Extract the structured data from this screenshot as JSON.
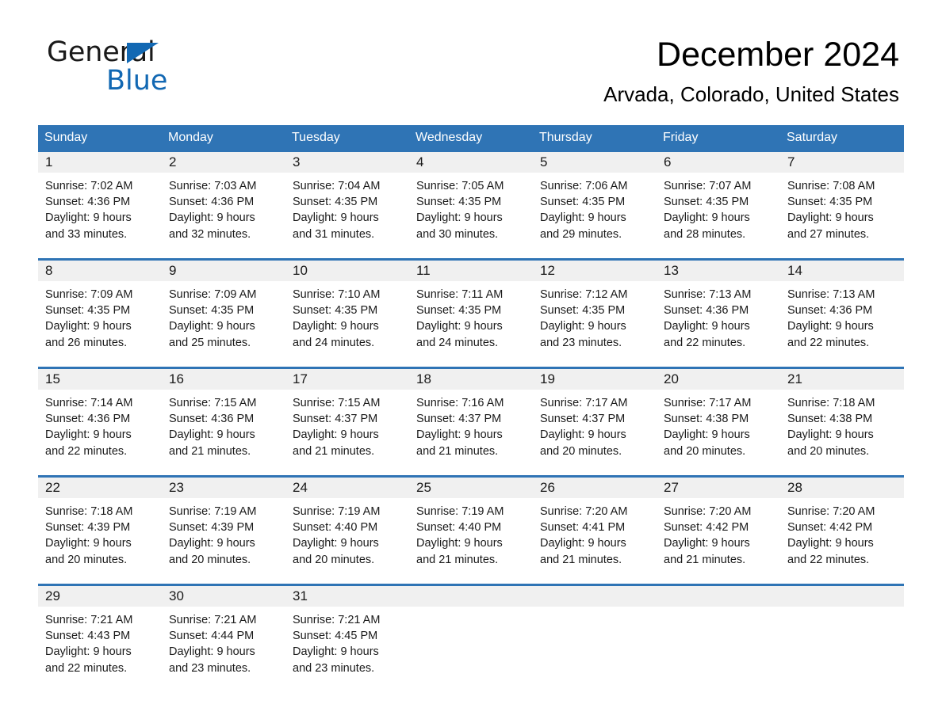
{
  "logo": {
    "word1": "General",
    "word2": "Blue",
    "triangle_color": "#1268b3"
  },
  "header": {
    "title": "December 2024",
    "location": "Arvada, Colorado, United States"
  },
  "theme": {
    "header_blue": "#2f74b5",
    "day_band_gray": "#f0f0f0",
    "text_color": "#1a1a1a"
  },
  "calendar": {
    "weekdays": [
      "Sunday",
      "Monday",
      "Tuesday",
      "Wednesday",
      "Thursday",
      "Friday",
      "Saturday"
    ],
    "weeks": [
      {
        "numbers": [
          "1",
          "2",
          "3",
          "4",
          "5",
          "6",
          "7"
        ],
        "cells": [
          {
            "sunrise": "Sunrise: 7:02 AM",
            "sunset": "Sunset: 4:36 PM",
            "daylight1": "Daylight: 9 hours",
            "daylight2": "and 33 minutes."
          },
          {
            "sunrise": "Sunrise: 7:03 AM",
            "sunset": "Sunset: 4:36 PM",
            "daylight1": "Daylight: 9 hours",
            "daylight2": "and 32 minutes."
          },
          {
            "sunrise": "Sunrise: 7:04 AM",
            "sunset": "Sunset: 4:35 PM",
            "daylight1": "Daylight: 9 hours",
            "daylight2": "and 31 minutes."
          },
          {
            "sunrise": "Sunrise: 7:05 AM",
            "sunset": "Sunset: 4:35 PM",
            "daylight1": "Daylight: 9 hours",
            "daylight2": "and 30 minutes."
          },
          {
            "sunrise": "Sunrise: 7:06 AM",
            "sunset": "Sunset: 4:35 PM",
            "daylight1": "Daylight: 9 hours",
            "daylight2": "and 29 minutes."
          },
          {
            "sunrise": "Sunrise: 7:07 AM",
            "sunset": "Sunset: 4:35 PM",
            "daylight1": "Daylight: 9 hours",
            "daylight2": "and 28 minutes."
          },
          {
            "sunrise": "Sunrise: 7:08 AM",
            "sunset": "Sunset: 4:35 PM",
            "daylight1": "Daylight: 9 hours",
            "daylight2": "and 27 minutes."
          }
        ]
      },
      {
        "numbers": [
          "8",
          "9",
          "10",
          "11",
          "12",
          "13",
          "14"
        ],
        "cells": [
          {
            "sunrise": "Sunrise: 7:09 AM",
            "sunset": "Sunset: 4:35 PM",
            "daylight1": "Daylight: 9 hours",
            "daylight2": "and 26 minutes."
          },
          {
            "sunrise": "Sunrise: 7:09 AM",
            "sunset": "Sunset: 4:35 PM",
            "daylight1": "Daylight: 9 hours",
            "daylight2": "and 25 minutes."
          },
          {
            "sunrise": "Sunrise: 7:10 AM",
            "sunset": "Sunset: 4:35 PM",
            "daylight1": "Daylight: 9 hours",
            "daylight2": "and 24 minutes."
          },
          {
            "sunrise": "Sunrise: 7:11 AM",
            "sunset": "Sunset: 4:35 PM",
            "daylight1": "Daylight: 9 hours",
            "daylight2": "and 24 minutes."
          },
          {
            "sunrise": "Sunrise: 7:12 AM",
            "sunset": "Sunset: 4:35 PM",
            "daylight1": "Daylight: 9 hours",
            "daylight2": "and 23 minutes."
          },
          {
            "sunrise": "Sunrise: 7:13 AM",
            "sunset": "Sunset: 4:36 PM",
            "daylight1": "Daylight: 9 hours",
            "daylight2": "and 22 minutes."
          },
          {
            "sunrise": "Sunrise: 7:13 AM",
            "sunset": "Sunset: 4:36 PM",
            "daylight1": "Daylight: 9 hours",
            "daylight2": "and 22 minutes."
          }
        ]
      },
      {
        "numbers": [
          "15",
          "16",
          "17",
          "18",
          "19",
          "20",
          "21"
        ],
        "cells": [
          {
            "sunrise": "Sunrise: 7:14 AM",
            "sunset": "Sunset: 4:36 PM",
            "daylight1": "Daylight: 9 hours",
            "daylight2": "and 22 minutes."
          },
          {
            "sunrise": "Sunrise: 7:15 AM",
            "sunset": "Sunset: 4:36 PM",
            "daylight1": "Daylight: 9 hours",
            "daylight2": "and 21 minutes."
          },
          {
            "sunrise": "Sunrise: 7:15 AM",
            "sunset": "Sunset: 4:37 PM",
            "daylight1": "Daylight: 9 hours",
            "daylight2": "and 21 minutes."
          },
          {
            "sunrise": "Sunrise: 7:16 AM",
            "sunset": "Sunset: 4:37 PM",
            "daylight1": "Daylight: 9 hours",
            "daylight2": "and 21 minutes."
          },
          {
            "sunrise": "Sunrise: 7:17 AM",
            "sunset": "Sunset: 4:37 PM",
            "daylight1": "Daylight: 9 hours",
            "daylight2": "and 20 minutes."
          },
          {
            "sunrise": "Sunrise: 7:17 AM",
            "sunset": "Sunset: 4:38 PM",
            "daylight1": "Daylight: 9 hours",
            "daylight2": "and 20 minutes."
          },
          {
            "sunrise": "Sunrise: 7:18 AM",
            "sunset": "Sunset: 4:38 PM",
            "daylight1": "Daylight: 9 hours",
            "daylight2": "and 20 minutes."
          }
        ]
      },
      {
        "numbers": [
          "22",
          "23",
          "24",
          "25",
          "26",
          "27",
          "28"
        ],
        "cells": [
          {
            "sunrise": "Sunrise: 7:18 AM",
            "sunset": "Sunset: 4:39 PM",
            "daylight1": "Daylight: 9 hours",
            "daylight2": "and 20 minutes."
          },
          {
            "sunrise": "Sunrise: 7:19 AM",
            "sunset": "Sunset: 4:39 PM",
            "daylight1": "Daylight: 9 hours",
            "daylight2": "and 20 minutes."
          },
          {
            "sunrise": "Sunrise: 7:19 AM",
            "sunset": "Sunset: 4:40 PM",
            "daylight1": "Daylight: 9 hours",
            "daylight2": "and 20 minutes."
          },
          {
            "sunrise": "Sunrise: 7:19 AM",
            "sunset": "Sunset: 4:40 PM",
            "daylight1": "Daylight: 9 hours",
            "daylight2": "and 21 minutes."
          },
          {
            "sunrise": "Sunrise: 7:20 AM",
            "sunset": "Sunset: 4:41 PM",
            "daylight1": "Daylight: 9 hours",
            "daylight2": "and 21 minutes."
          },
          {
            "sunrise": "Sunrise: 7:20 AM",
            "sunset": "Sunset: 4:42 PM",
            "daylight1": "Daylight: 9 hours",
            "daylight2": "and 21 minutes."
          },
          {
            "sunrise": "Sunrise: 7:20 AM",
            "sunset": "Sunset: 4:42 PM",
            "daylight1": "Daylight: 9 hours",
            "daylight2": "and 22 minutes."
          }
        ]
      },
      {
        "numbers": [
          "29",
          "30",
          "31",
          "",
          "",
          "",
          ""
        ],
        "cells": [
          {
            "sunrise": "Sunrise: 7:21 AM",
            "sunset": "Sunset: 4:43 PM",
            "daylight1": "Daylight: 9 hours",
            "daylight2": "and 22 minutes."
          },
          {
            "sunrise": "Sunrise: 7:21 AM",
            "sunset": "Sunset: 4:44 PM",
            "daylight1": "Daylight: 9 hours",
            "daylight2": "and 23 minutes."
          },
          {
            "sunrise": "Sunrise: 7:21 AM",
            "sunset": "Sunset: 4:45 PM",
            "daylight1": "Daylight: 9 hours",
            "daylight2": "and 23 minutes."
          },
          {
            "sunrise": "",
            "sunset": "",
            "daylight1": "",
            "daylight2": ""
          },
          {
            "sunrise": "",
            "sunset": "",
            "daylight1": "",
            "daylight2": ""
          },
          {
            "sunrise": "",
            "sunset": "",
            "daylight1": "",
            "daylight2": ""
          },
          {
            "sunrise": "",
            "sunset": "",
            "daylight1": "",
            "daylight2": ""
          }
        ]
      }
    ]
  }
}
